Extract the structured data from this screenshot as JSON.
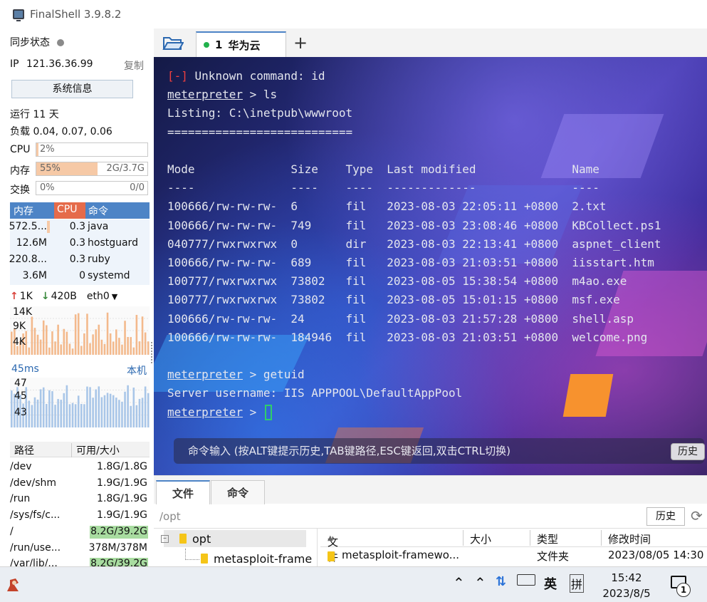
{
  "window": {
    "title": "FinalShell 3.9.8.2"
  },
  "sidebar": {
    "sync_label": "同步状态",
    "ip_label": "IP",
    "ip_value": "121.36.36.99",
    "copy_label": "复制",
    "sysinfo_button": "系统信息",
    "uptime": "运行 11 天",
    "load": "负载 0.04, 0.07, 0.06",
    "cpu": {
      "label": "CPU",
      "value": "2%",
      "percent": 2
    },
    "mem": {
      "label": "内存",
      "value": "55%",
      "detail": "2G/3.7G",
      "percent": 55
    },
    "swap": {
      "label": "交换",
      "value": "0%",
      "detail": "0/0",
      "percent": 0
    },
    "process_table": {
      "headers": [
        "内存",
        "CPU",
        "命令"
      ],
      "rows": [
        {
          "mem": "572.5...",
          "cpu": "0.3",
          "cmd": "java"
        },
        {
          "mem": "12.6M",
          "cpu": "0.3",
          "cmd": "hostguard"
        },
        {
          "mem": "220.8...",
          "cpu": "0.3",
          "cmd": "ruby"
        },
        {
          "mem": "3.6M",
          "cpu": "0",
          "cmd": "systemd"
        }
      ]
    },
    "network": {
      "up": "1K",
      "down": "420B",
      "interface": "eth0",
      "y_labels": [
        "14K",
        "9K",
        "4K"
      ]
    },
    "latency": {
      "value": "45ms",
      "target": "本机",
      "y_labels": [
        "47",
        "45",
        "43"
      ]
    },
    "disk_table": {
      "headers": [
        "路径",
        "可用/大小"
      ],
      "rows": [
        {
          "path": "/dev",
          "value": "1.8G/1.8G",
          "highlight": false
        },
        {
          "path": "/dev/shm",
          "value": "1.9G/1.9G",
          "highlight": false
        },
        {
          "path": "/run",
          "value": "1.8G/1.9G",
          "highlight": false
        },
        {
          "path": "/sys/fs/c...",
          "value": "1.9G/1.9G",
          "highlight": false
        },
        {
          "path": "/",
          "value": "8.2G/39.2G",
          "highlight": true
        },
        {
          "path": "/run/use...",
          "value": "378M/378M",
          "highlight": false
        },
        {
          "path": "/var/lib/...",
          "value": "8.2G/39.2G",
          "highlight": true
        }
      ]
    }
  },
  "tabs": {
    "active": {
      "number": "1",
      "label": "华为云"
    },
    "add": "+"
  },
  "terminal": {
    "lines": [
      {
        "prefix": "[-]",
        "text": " Unknown command: id"
      },
      {
        "prompt": "meterpreter",
        "text": " > ls"
      },
      {
        "text": "Listing: C:\\inetpub\\wwwroot"
      },
      {
        "text": "==========================="
      },
      {
        "text": ""
      },
      {
        "text": "Mode              Size    Type  Last modified              Name"
      },
      {
        "text": "----              ----    ----  -------------              ----"
      },
      {
        "text": "100666/rw-rw-rw-  6       fil   2023-08-03 22:05:11 +0800  2.txt"
      },
      {
        "text": "100666/rw-rw-rw-  749     fil   2023-08-03 23:08:46 +0800  KBCollect.ps1"
      },
      {
        "text": "040777/rwxrwxrwx  0       dir   2023-08-03 22:13:41 +0800  aspnet_client"
      },
      {
        "text": "100666/rw-rw-rw-  689     fil   2023-08-03 21:03:51 +0800  iisstart.htm"
      },
      {
        "text": "100777/rwxrwxrwx  73802   fil   2023-08-05 15:38:54 +0800  m4ao.exe"
      },
      {
        "text": "100777/rwxrwxrwx  73802   fil   2023-08-05 15:01:15 +0800  msf.exe"
      },
      {
        "text": "100666/rw-rw-rw-  24      fil   2023-08-03 21:57:28 +0800  shell.asp"
      },
      {
        "text": "100666/rw-rw-rw-  184946  fil   2023-08-03 21:03:51 +0800  welcome.png"
      },
      {
        "text": ""
      },
      {
        "prompt": "meterpreter",
        "text": " > getuid"
      },
      {
        "text": "Server username: IIS APPPOOL\\DefaultAppPool"
      },
      {
        "prompt": "meterpreter",
        "text": " > ",
        "cursor": true
      }
    ],
    "input_placeholder": "命令输入 (按ALT键提示历史,TAB键路径,ESC键返回,双击CTRL切换)",
    "history_button": "历史"
  },
  "bottom": {
    "tabs": [
      "文件",
      "命令"
    ],
    "path": "/opt",
    "history_button": "历史",
    "tree": {
      "root": "opt",
      "child": "metasploit-frame"
    },
    "file_headers": [
      "文件名",
      "大小",
      "类型",
      "修改时间"
    ],
    "files": [
      {
        "name": "metasploit-framewo...",
        "size": "",
        "type": "文件夹",
        "modified": "2023/08/05 14:30"
      }
    ]
  },
  "taskbar": {
    "ime_lang": "英",
    "ime_mode": "拼",
    "time": "15:42",
    "date": "2023/8/5",
    "notification_count": "1"
  },
  "colors": {
    "accent": "#4d84c6",
    "cpu_header": "#e56b4a",
    "mem_bar": "#f6c9a6",
    "disk_highlight": "#a8dca0",
    "prompt_error": "#ee3f3f",
    "cursor": "#2fce6a"
  }
}
